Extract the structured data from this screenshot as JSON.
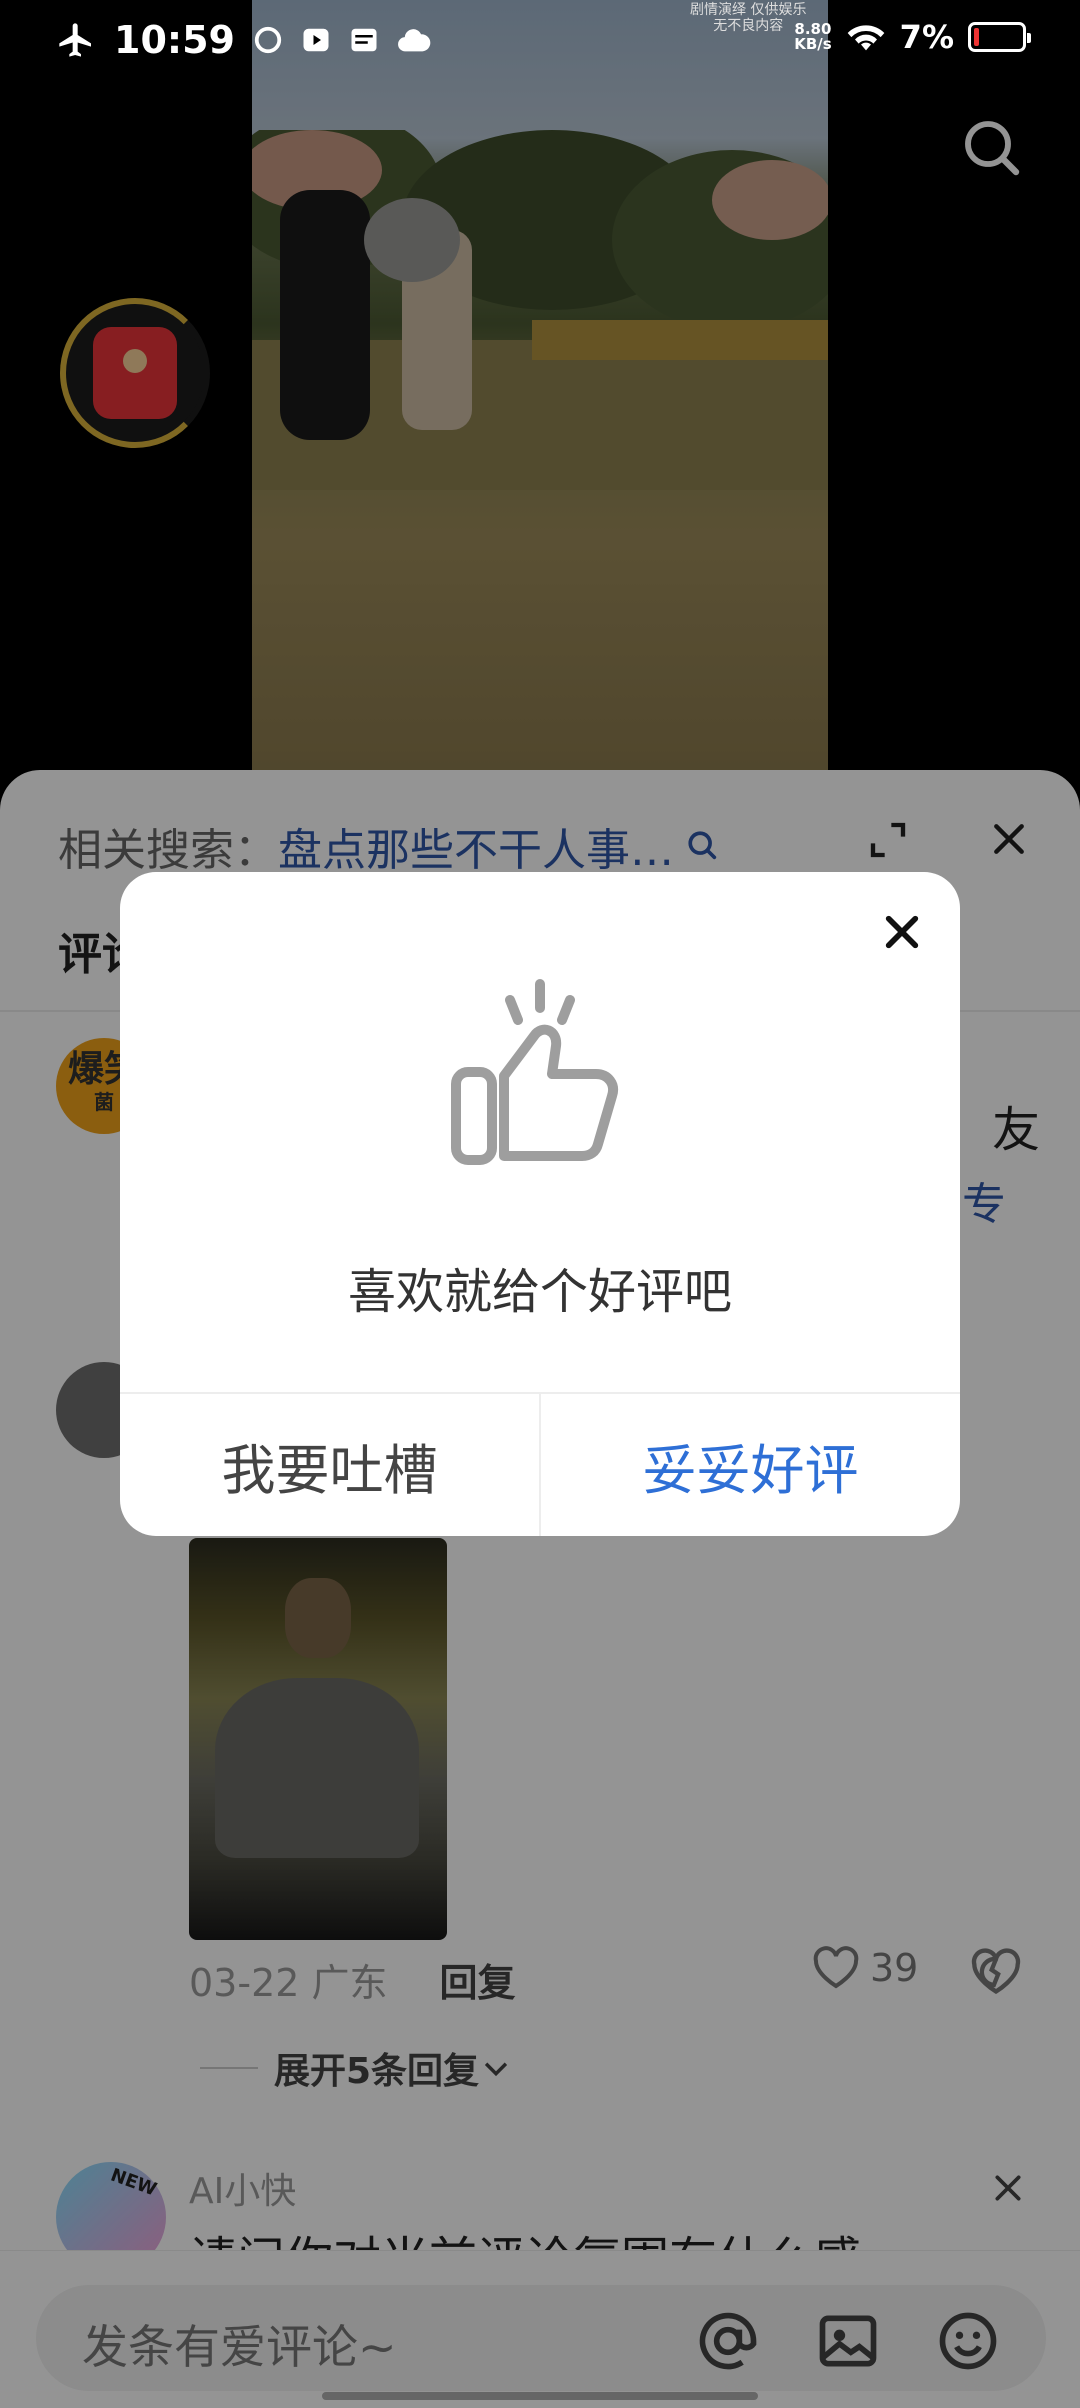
{
  "status_bar": {
    "time": "10:59",
    "net_speed_value": "8.80",
    "net_speed_unit": "KB/s",
    "battery_percent": "7%",
    "ticker_line1": "剧情演绎 仅供娱乐",
    "ticker_line2": "无不良内容"
  },
  "sheet": {
    "related_label": "相关搜索：",
    "related_query": "盘点那些不干人事…",
    "tab_label": "评论",
    "comment1_avatar_line1": "爆笑",
    "comment1_avatar_line2": "菌",
    "comment1_right_text": "友",
    "comment1_right_link": "专",
    "comment2": {
      "date": "03-22",
      "location": "广东",
      "reply_label": "回复",
      "likes": "39"
    },
    "expand_replies": "展开5条回复",
    "ai": {
      "name": "AI小快",
      "badge": "NEW",
      "question": "请问你对当前评论氛围有什么感"
    },
    "input_placeholder": "发条有爱评论~"
  },
  "dialog": {
    "message": "喜欢就给个好评吧",
    "secondary_button": "我要吐槽",
    "primary_button": "妥妥好评"
  },
  "colors": {
    "primary_blue": "#2e6fd6",
    "link_blue": "#2f56a8",
    "redpacket_red": "#e8343a",
    "ring_gold": "#d9b23b"
  }
}
